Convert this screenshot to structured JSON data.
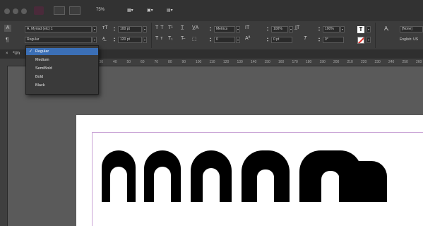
{
  "app_bar": {
    "zoom": "75%",
    "icons": [
      "close-dot",
      "minimize-dot",
      "zoom-dot",
      "app-logo",
      "bridge",
      "view-options",
      "screen-mode",
      "arrange-documents"
    ]
  },
  "control_panel": {
    "font_family": "A, Myriad (etc) 1",
    "font_style": "Regular",
    "font_size": "100 pt",
    "leading": "120 pt",
    "kerning": "Metrics",
    "tracking": "0",
    "vertical_scale": "100%",
    "horizontal_scale": "100%",
    "baseline_shift": "0 pt",
    "skew": "0°",
    "language": "[None]",
    "secondary_language": "English: US"
  },
  "style_dropdown": {
    "items": [
      "Regular",
      "Medium",
      "SemiBold",
      "Bold",
      "Black"
    ],
    "selected": "Regular"
  },
  "rulers": {
    "horizontal_ticks": [
      "0",
      "10",
      "20",
      "30",
      "40",
      "50",
      "60",
      "70",
      "80",
      "90",
      "100",
      "110",
      "120",
      "130",
      "140",
      "150",
      "160",
      "170",
      "180",
      "190",
      "200",
      "210",
      "220",
      "230",
      "240",
      "250",
      "260"
    ]
  },
  "document": {
    "tab_label": "*Un"
  },
  "canvas_text": "nnnnn",
  "colors": {
    "panel": "#3c3c3c",
    "app_bar": "#323232",
    "selection": "#3b6fb6",
    "guide": "#c9a4d6",
    "page": "#ffffff"
  }
}
